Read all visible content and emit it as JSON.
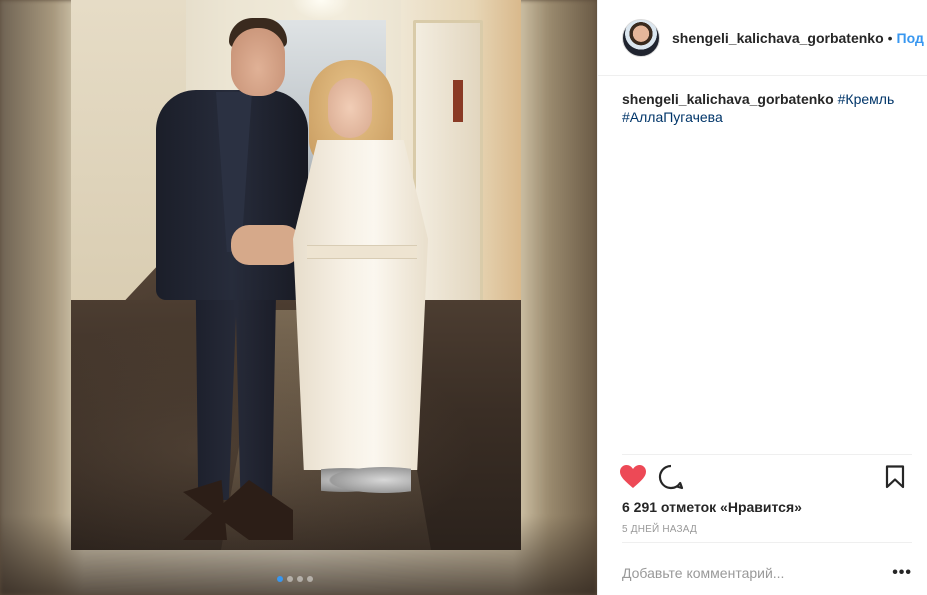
{
  "post": {
    "username": "shengeli_kalichava_gorbatenko",
    "separator": "•",
    "follow_label": "Под",
    "caption": {
      "username": "shengeli_kalichava_gorbatenko",
      "hashtags": [
        "#Кремль",
        "#АллаПугачева"
      ]
    },
    "likes_text": "6 291 отметок «Нравится»",
    "timestamp": "5 ДНЕЙ НАЗАД",
    "comment_placeholder": "Добавьте комментарий...",
    "more_label": "•••"
  },
  "carousel": {
    "total": 4,
    "active": 1
  },
  "icons": {
    "like": "heart-icon",
    "comment": "comment-icon",
    "save": "bookmark-icon",
    "more": "more-options-icon"
  },
  "colors": {
    "heart": "#ed4956",
    "link": "#003569",
    "follow": "#3897f0",
    "muted": "#999999",
    "text": "#262626"
  }
}
